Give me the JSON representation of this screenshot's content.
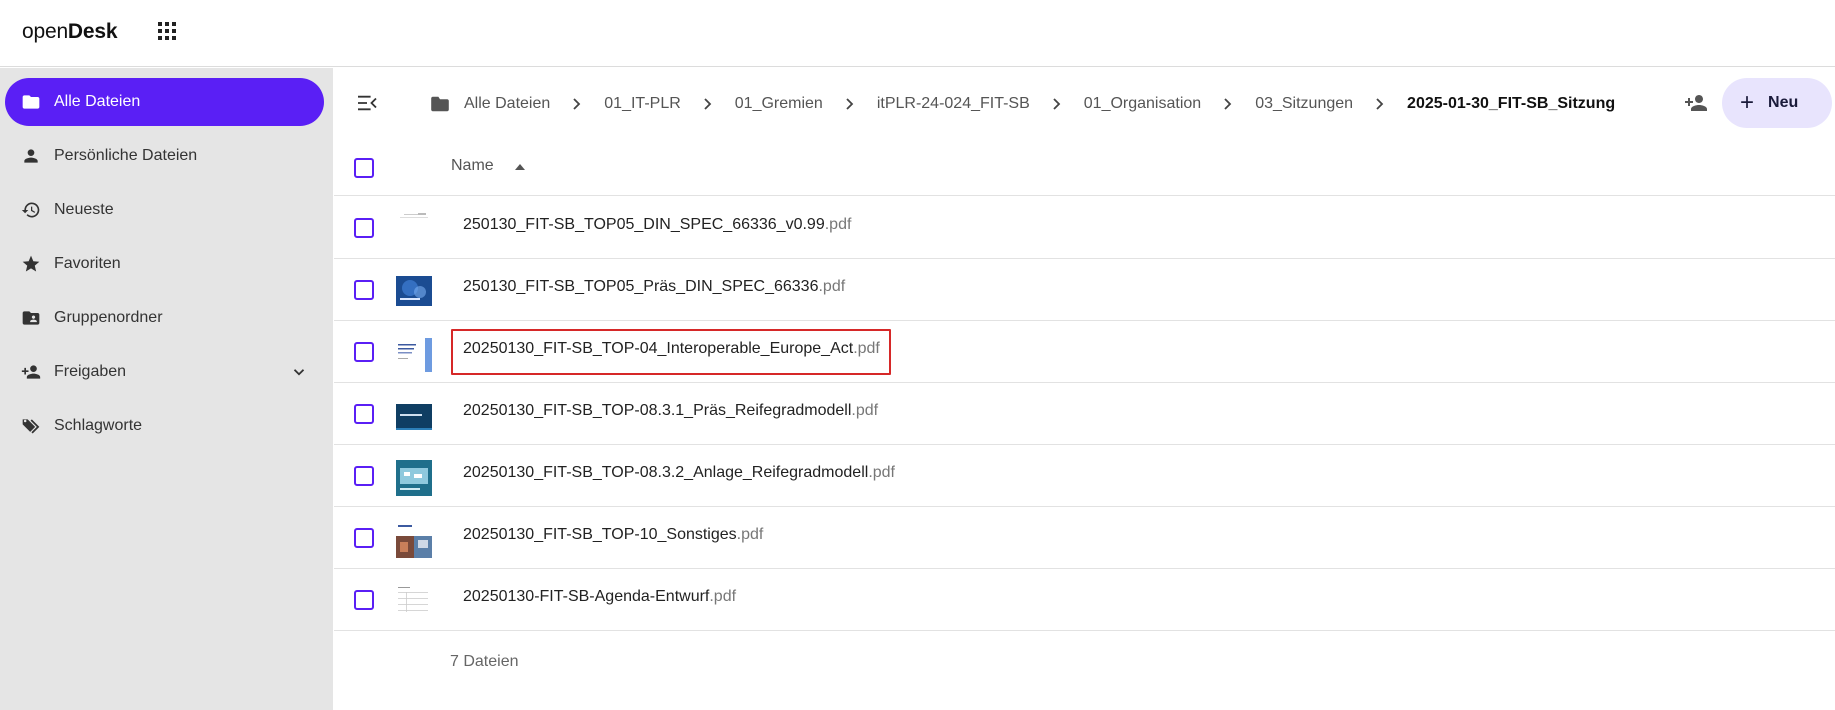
{
  "app": {
    "logo_light": "open",
    "logo_bold": "Desk"
  },
  "sidebar": {
    "items": [
      {
        "label": "Alle Dateien",
        "icon": "folder-icon",
        "active": true
      },
      {
        "label": "Persönliche Dateien",
        "icon": "person-icon"
      },
      {
        "label": "Neueste",
        "icon": "history-icon"
      },
      {
        "label": "Favoriten",
        "icon": "star-icon"
      },
      {
        "label": "Gruppenordner",
        "icon": "group-folder-icon"
      },
      {
        "label": "Freigaben",
        "icon": "person-add-icon",
        "expandable": true
      },
      {
        "label": "Schlagworte",
        "icon": "tags-icon"
      }
    ]
  },
  "breadcrumb": {
    "items": [
      "Alle Dateien",
      "01_IT-PLR",
      "01_Gremien",
      "itPLR-24-024_FIT-SB",
      "01_Organisation",
      "03_Sitzungen",
      "2025-01-30_FIT-SB_Sitzung"
    ]
  },
  "toolbar": {
    "new_label": "Neu"
  },
  "table": {
    "header_name": "Name",
    "sort": "ascending",
    "files": [
      {
        "name": "250130_FIT-SB_TOP05_DIN_SPEC_66336_v0.99",
        "ext": ".pdf",
        "thumb": "white-doc"
      },
      {
        "name": "250130_FIT-SB_TOP05_Präs_DIN_SPEC_66336",
        "ext": ".pdf",
        "thumb": "blue-dark"
      },
      {
        "name": "20250130_FIT-SB_TOP-04_Interoperable_Europe_Act",
        "ext": ".pdf",
        "thumb": "white-blue",
        "highlighted": true
      },
      {
        "name": "20250130_FIT-SB_TOP-08.3.1_Präs_Reifegradmodell",
        "ext": ".pdf",
        "thumb": "navy"
      },
      {
        "name": "20250130_FIT-SB_TOP-08.3.2_Anlage_Reifegradmodell",
        "ext": ".pdf",
        "thumb": "teal"
      },
      {
        "name": "20250130_FIT-SB_TOP-10_Sonstiges",
        "ext": ".pdf",
        "thumb": "photo"
      },
      {
        "name": "20250130-FIT-SB-Agenda-Entwurf",
        "ext": ".pdf",
        "thumb": "white-table"
      }
    ],
    "count_label": "7 Dateien"
  },
  "colors": {
    "accent": "#5a1ff5",
    "sidebar_bg": "#e5e5e5",
    "new_button_bg": "#e8e4fd",
    "highlight": "#d62828"
  }
}
